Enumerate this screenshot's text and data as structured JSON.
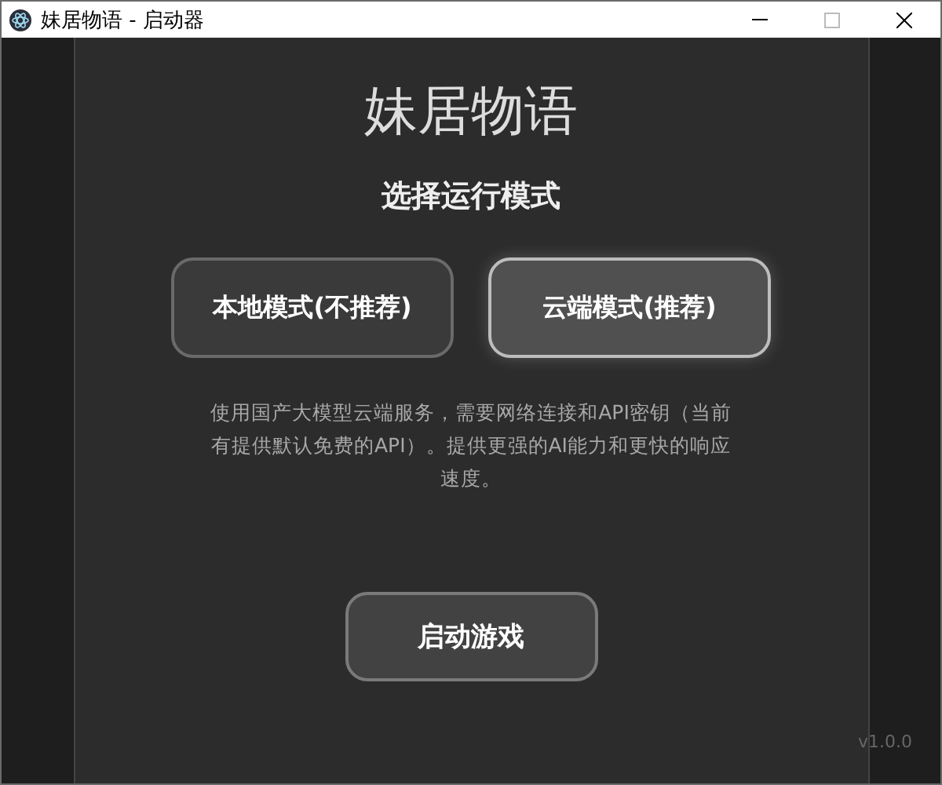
{
  "window": {
    "title": "妹居物语 - 启动器"
  },
  "title": "妹居物语",
  "subtitle": "选择运行模式",
  "modes": [
    {
      "label": "本地模式(不推荐)",
      "selected": false
    },
    {
      "label": "云端模式(推荐)",
      "selected": true
    }
  ],
  "description": "使用国产大模型云端服务，需要网络连接和API密钥（当前有提供默认免费的API）。提供更强的AI能力和更快的响应速度。",
  "start_button": "启动游戏",
  "version": "v1.0.0"
}
